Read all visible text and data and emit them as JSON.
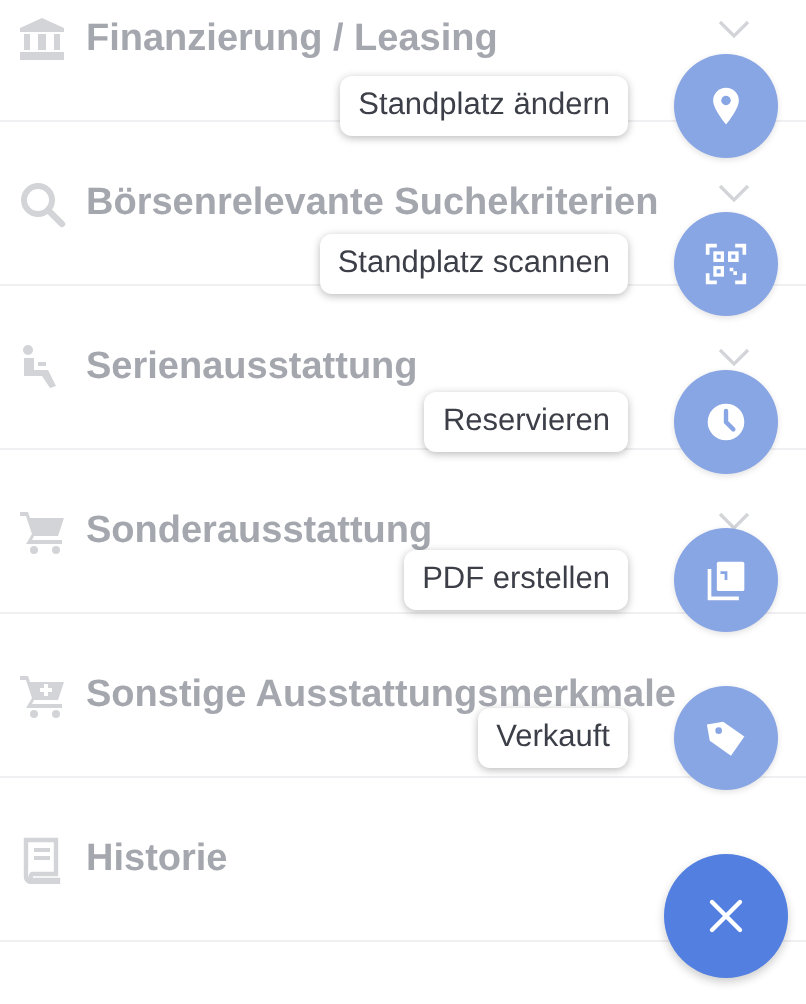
{
  "sections": [
    {
      "title": "Finanzierung / Leasing",
      "chevron": true
    },
    {
      "title": "Börsenrelevante Suchekriterien",
      "chevron": true
    },
    {
      "title": "Serienausstattung",
      "chevron": true
    },
    {
      "title": "Sonderausstattung",
      "chevron": true
    },
    {
      "title": "Sonstige Ausstattungsmerkmale",
      "chevron": false
    },
    {
      "title": "Historie",
      "chevron": false
    }
  ],
  "actions": [
    {
      "label": "Standplatz ändern"
    },
    {
      "label": "Standplatz scannen"
    },
    {
      "label": "Reservieren"
    },
    {
      "label": "PDF erstellen"
    },
    {
      "label": "Verkauft"
    }
  ]
}
